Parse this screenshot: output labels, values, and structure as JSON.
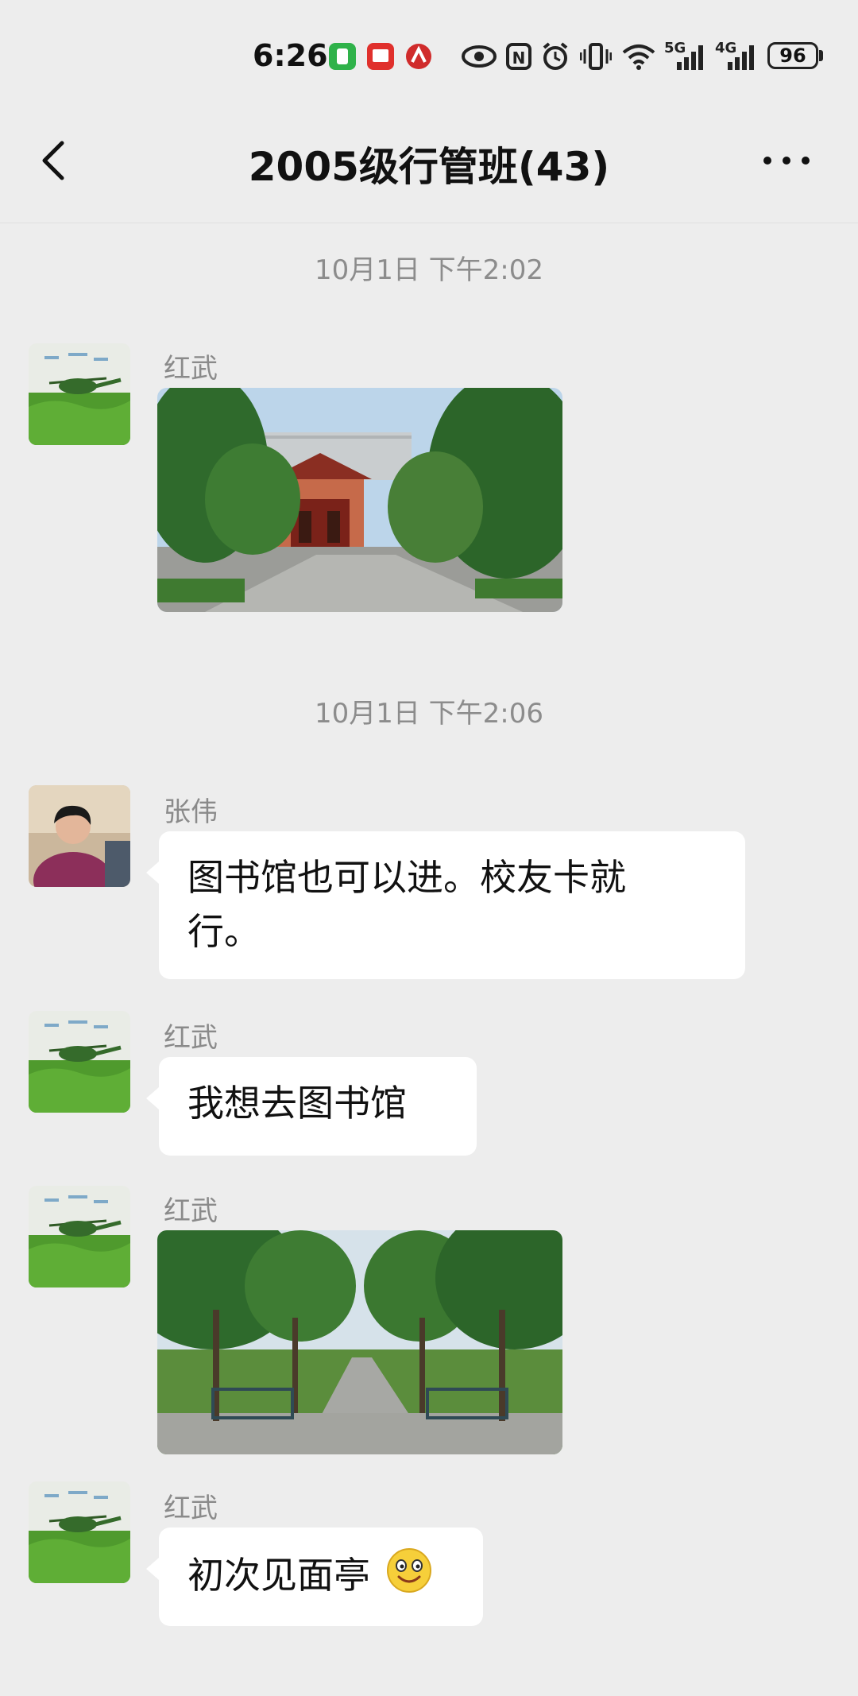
{
  "status_bar": {
    "time": "6:26",
    "net5g": "5G",
    "net4g": "4G",
    "battery": "96"
  },
  "header": {
    "title": "2005级行管班(43)"
  },
  "messages": [
    {
      "type": "timestamp",
      "text": "10月1日 下午2:02"
    },
    {
      "type": "image",
      "sender": "红武"
    },
    {
      "type": "timestamp",
      "text": "10月1日 下午2:06"
    },
    {
      "type": "text",
      "sender": "张伟",
      "line1": "图书馆也可以进。校友卡就",
      "line2": "行。"
    },
    {
      "type": "text",
      "sender": "红武",
      "line1": "我想去图书馆"
    },
    {
      "type": "image",
      "sender": "红武"
    },
    {
      "type": "text",
      "sender": "红武",
      "line1": "初次见面亭"
    }
  ]
}
